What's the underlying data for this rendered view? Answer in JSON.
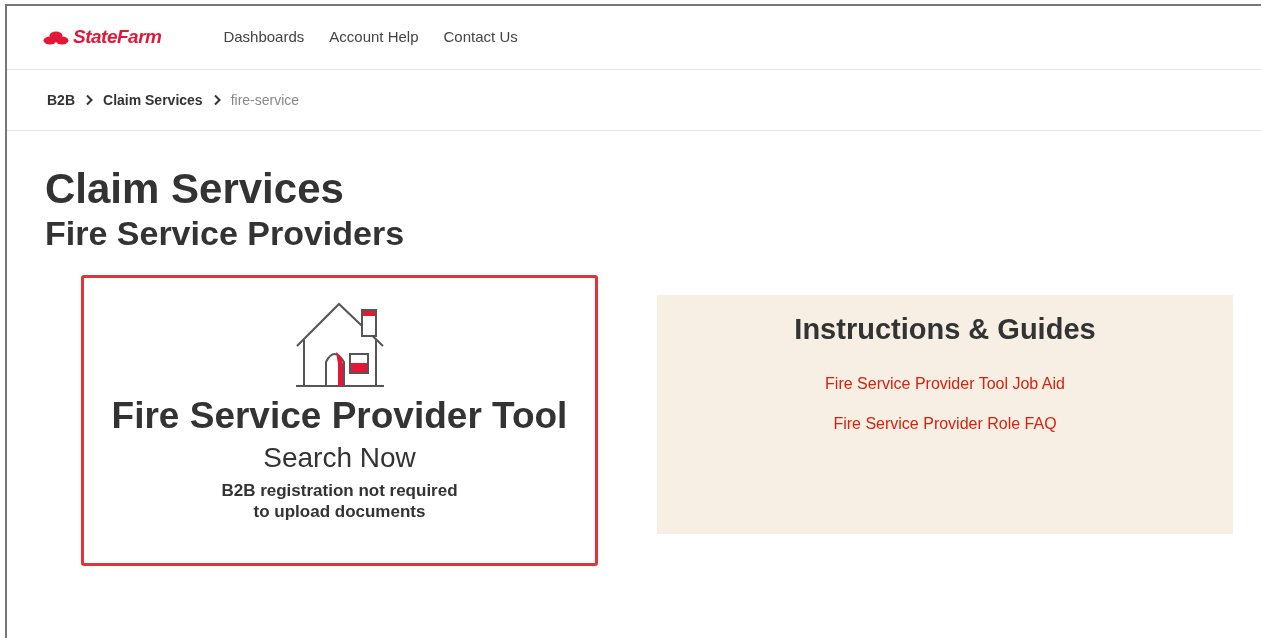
{
  "header": {
    "logo": "StateFarm",
    "nav": [
      "Dashboards",
      "Account Help",
      "Contact Us"
    ]
  },
  "breadcrumb": [
    {
      "label": "B2B",
      "current": false
    },
    {
      "label": "Claim Services",
      "current": false
    },
    {
      "label": "fire-service",
      "current": true
    }
  ],
  "title": "Claim Services",
  "subtitle": "Fire Service Providers",
  "tool_card": {
    "title": "Fire Service Provider Tool",
    "action": "Search Now",
    "note_lines": [
      "B2B registration not required",
      "to upload documents"
    ]
  },
  "guides": {
    "title": "Instructions & Guides",
    "links": [
      "Fire Service Provider Tool Job Aid",
      "Fire Service Provider Role FAQ"
    ]
  }
}
